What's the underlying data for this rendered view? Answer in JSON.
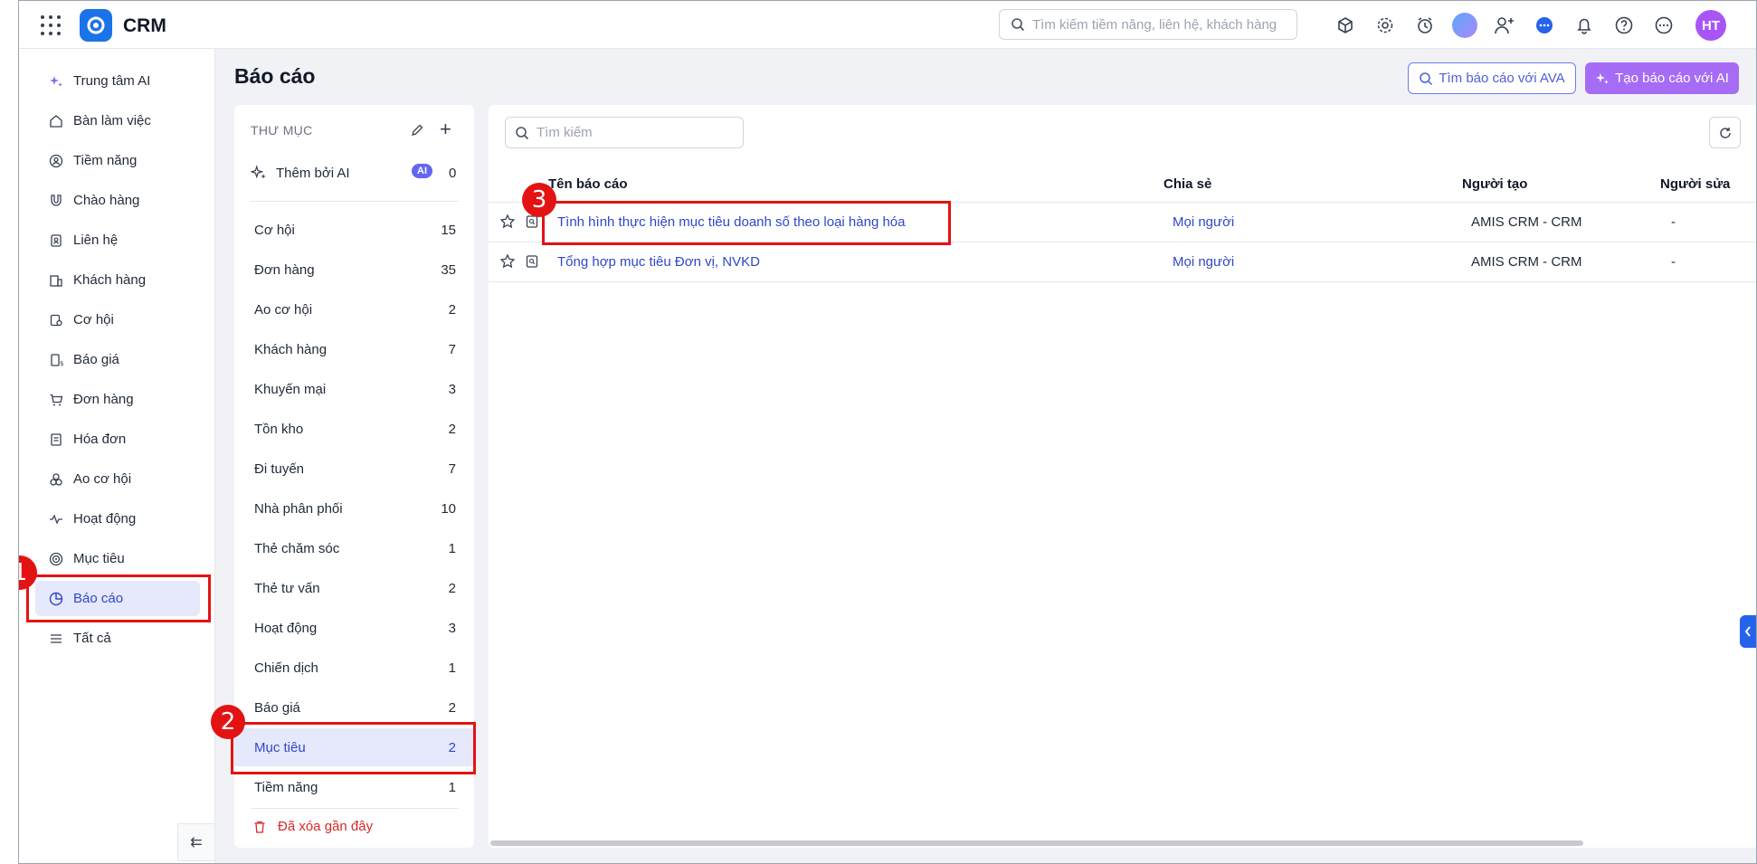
{
  "app": {
    "name": "CRM",
    "user_initials": "HT"
  },
  "global_search": {
    "placeholder": "Tìm kiếm tiềm năng, liên hệ, khách hàng"
  },
  "sidebar": {
    "items": [
      {
        "label": "Trung tâm AI",
        "icon": "sparkle-icon"
      },
      {
        "label": "Bàn làm việc",
        "icon": "home-icon"
      },
      {
        "label": "Tiềm năng",
        "icon": "lead-icon"
      },
      {
        "label": "Chào hàng",
        "icon": "magnet-icon"
      },
      {
        "label": "Liên hệ",
        "icon": "contact-card-icon"
      },
      {
        "label": "Khách hàng",
        "icon": "building-icon"
      },
      {
        "label": "Cơ hội",
        "icon": "opportunity-icon"
      },
      {
        "label": "Báo giá",
        "icon": "quote-icon"
      },
      {
        "label": "Đơn hàng",
        "icon": "cart-icon"
      },
      {
        "label": "Hóa đơn",
        "icon": "invoice-icon"
      },
      {
        "label": "Ao cơ hội",
        "icon": "pool-icon"
      },
      {
        "label": "Hoạt động",
        "icon": "activity-icon"
      },
      {
        "label": "Mục tiêu",
        "icon": "target-icon"
      },
      {
        "label": "Báo cáo",
        "icon": "pie-chart-icon",
        "active": true
      },
      {
        "label": "Tất cả",
        "icon": "menu-icon"
      }
    ]
  },
  "page": {
    "title": "Báo cáo",
    "find_ava_label": "Tìm báo cáo với AVA",
    "create_ai_label": "Tạo báo cáo với AI"
  },
  "folders": {
    "header": "THƯ MỤC",
    "ai_folder": {
      "label": "Thêm bởi AI",
      "badge": "AI",
      "count": "0"
    },
    "items": [
      {
        "label": "Cơ hội",
        "count": "15"
      },
      {
        "label": "Đơn hàng",
        "count": "35"
      },
      {
        "label": "Ao cơ hội",
        "count": "2"
      },
      {
        "label": "Khách hàng",
        "count": "7"
      },
      {
        "label": "Khuyến mại",
        "count": "3"
      },
      {
        "label": "Tồn kho",
        "count": "2"
      },
      {
        "label": "Đi tuyến",
        "count": "7"
      },
      {
        "label": "Nhà phân phối",
        "count": "10"
      },
      {
        "label": "Thẻ chăm sóc",
        "count": "1"
      },
      {
        "label": "Thẻ tư vấn",
        "count": "2"
      },
      {
        "label": "Hoạt động",
        "count": "3"
      },
      {
        "label": "Chiến dịch",
        "count": "1"
      },
      {
        "label": "Báo giá",
        "count": "2"
      },
      {
        "label": "Mục tiêu",
        "count": "2",
        "active": true
      },
      {
        "label": "Tiềm năng",
        "count": "1"
      }
    ],
    "trash_label": "Đã xóa gần đây"
  },
  "report_list": {
    "search_placeholder": "Tìm kiếm",
    "columns": [
      "Tên báo cáo",
      "Chia sẻ",
      "Người tạo",
      "Người sửa"
    ],
    "rows": [
      {
        "name": "Tình hình thực hiện mục tiêu doanh số theo loại hàng hóa",
        "share": "Mọi người",
        "creator": "AMIS CRM - CRM",
        "editor": "-"
      },
      {
        "name": "Tổng hợp mục tiêu Đơn vị, NVKD",
        "share": "Mọi người",
        "creator": "AMIS CRM - CRM",
        "editor": "-"
      }
    ]
  },
  "annotations": {
    "step1": "1",
    "step2": "2",
    "step3": "3"
  },
  "colors": {
    "accent": "#2f47c8",
    "active_bg": "#e6e8fb",
    "ai_button": "#a66cf6",
    "annotation": "#e41313",
    "logo": "#1a73e8"
  }
}
